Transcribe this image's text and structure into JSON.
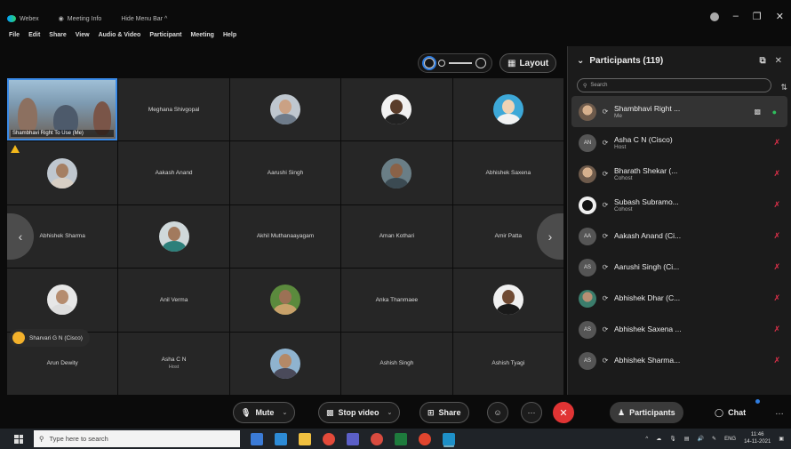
{
  "titlebar": {
    "app": "Webex",
    "meeting_info": "Meeting Info",
    "hide_menu_bar": "Hide Menu Bar ^",
    "controls": [
      "–",
      "❐",
      "✕"
    ]
  },
  "menu": [
    "File",
    "Edit",
    "Share",
    "View",
    "Audio & Video",
    "Participant",
    "Meeting",
    "Help"
  ],
  "toolbar": {
    "layout_label": "Layout"
  },
  "grid": {
    "self_label": "Shambhavi Right To Use (Me)",
    "tiles": [
      {
        "name": "Meghana Shivgopal"
      },
      {
        "name": ""
      },
      {
        "name": ""
      },
      {
        "name": ""
      },
      {
        "name": ""
      },
      {
        "name": "Aakash Anand"
      },
      {
        "name": "Aarushi Singh"
      },
      {
        "name": ""
      },
      {
        "name": "Abhishek Saxena"
      },
      {
        "name": "Abhishek Sharma"
      },
      {
        "name": ""
      },
      {
        "name": "Akhil Muthanaayagam"
      },
      {
        "name": "Aman Kothari"
      },
      {
        "name": "Amir Patta"
      },
      {
        "name": ""
      },
      {
        "name": "Anil Verma"
      },
      {
        "name": ""
      },
      {
        "name": "Anka Thanmaee"
      },
      {
        "name": ""
      },
      {
        "name": "Arun Dewity"
      },
      {
        "name": "Asha C N",
        "sub": "Host"
      },
      {
        "name": ""
      },
      {
        "name": "Ashish Singh"
      },
      {
        "name": "Ashish Tyagi"
      }
    ],
    "hand_raise_name": "Sharvari G N (Cisco)"
  },
  "participants": {
    "header": "Participants (119)",
    "search_placeholder": "Search",
    "list": [
      {
        "initials": "",
        "name": "Shambhavi Right ...",
        "role": "Me",
        "avatar": "me"
      },
      {
        "initials": "AN",
        "name": "Asha C N (Cisco)",
        "role": "Host",
        "avatar": "initials"
      },
      {
        "initials": "",
        "name": "Bharath Shekar (...",
        "role": "Cohost",
        "avatar": "photo"
      },
      {
        "initials": "",
        "name": "Subash Subramo...",
        "role": "Cohost",
        "avatar": "dark"
      },
      {
        "initials": "AA",
        "name": "Aakash Anand (Ci...",
        "role": "",
        "avatar": "initials"
      },
      {
        "initials": "AS",
        "name": "Aarushi Singh (Ci...",
        "role": "",
        "avatar": "initials"
      },
      {
        "initials": "",
        "name": "Abhishek Dhar (C...",
        "role": "",
        "avatar": "green"
      },
      {
        "initials": "AS",
        "name": "Abhishek Saxena ...",
        "role": "",
        "avatar": "initials"
      },
      {
        "initials": "AS",
        "name": "Abhishek Sharma...",
        "role": "",
        "avatar": "initials"
      }
    ]
  },
  "controls": {
    "mute": "Mute",
    "stop_video": "Stop video",
    "share": "Share",
    "participants": "Participants",
    "chat": "Chat"
  },
  "taskbar": {
    "search_placeholder": "Type here to search",
    "lang": "ENG",
    "time": "11:46",
    "date": "14-11-2021"
  },
  "colors": {
    "accent": "#2f7de1",
    "leave": "#e03434",
    "muted": "#e0304a"
  }
}
